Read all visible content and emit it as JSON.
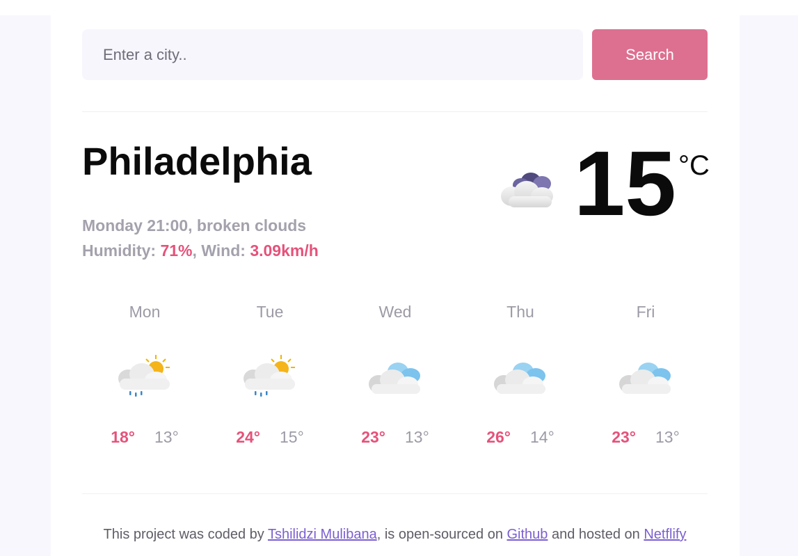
{
  "search": {
    "placeholder": "Enter a city..",
    "button_label": "Search"
  },
  "current": {
    "city": "Philadelphia",
    "datetime": "Monday 21:00",
    "description": "broken clouds",
    "humidity_label": "Humidity:",
    "humidity_value": "71%",
    "wind_label": "Wind:",
    "wind_value": "3.09km/h",
    "temperature": "15",
    "unit": "°C",
    "icon": "broken-clouds-night-icon"
  },
  "forecast": [
    {
      "day": "Mon",
      "max": "18°",
      "min": "13°",
      "icon": "sun-rain-icon"
    },
    {
      "day": "Tue",
      "max": "24°",
      "min": "15°",
      "icon": "sun-rain-icon"
    },
    {
      "day": "Wed",
      "max": "23°",
      "min": "13°",
      "icon": "clouds-icon"
    },
    {
      "day": "Thu",
      "max": "26°",
      "min": "14°",
      "icon": "clouds-icon"
    },
    {
      "day": "Fri",
      "max": "23°",
      "min": "13°",
      "icon": "clouds-icon"
    }
  ],
  "footer": {
    "t1": "This project was coded by ",
    "author": "Tshilidzi Mulibana",
    "t2": ", is open-sourced on ",
    "repo": "Github",
    "t3": " and hosted on ",
    "host": "Netflify"
  },
  "colors": {
    "accent_pink": "#e5527a",
    "button_pink": "#dd7090",
    "link_purple": "#7b5fd0"
  }
}
